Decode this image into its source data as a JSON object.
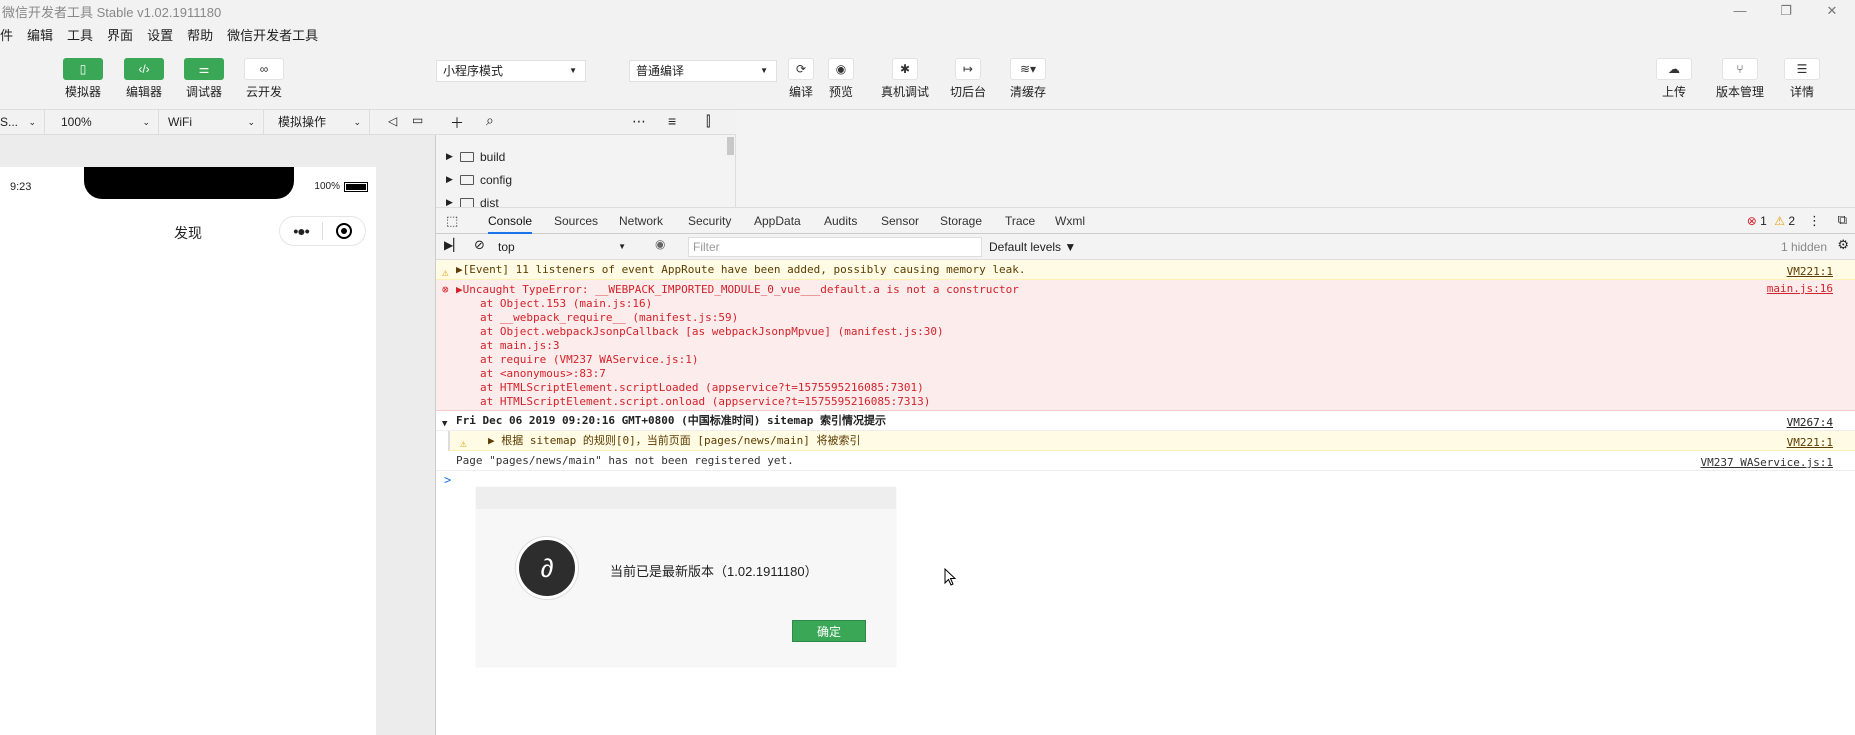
{
  "window": {
    "title": "微信开发者工具 Stable v1.02.1911180",
    "min": "—",
    "restore": "❐",
    "close": "✕"
  },
  "menu": [
    "件",
    "编辑",
    "工具",
    "界面",
    "设置",
    "帮助",
    "微信开发者工具"
  ],
  "toolbar": {
    "simulator": "模拟器",
    "editor": "编辑器",
    "debugger": "调试器",
    "cloud": "云开发",
    "mode_select": "小程序模式",
    "compile_select": "普通编译",
    "compile": "编译",
    "preview": "预览",
    "remote_debug": "真机调试",
    "background": "切后台",
    "clear_cache": "清缓存",
    "upload": "上传",
    "version_mgmt": "版本管理",
    "details": "详情"
  },
  "simbar": {
    "device": "S...",
    "zoom": "100%",
    "network": "WiFi",
    "operation": "模拟操作"
  },
  "phone": {
    "time": "9:23",
    "battery": "100%",
    "nav_title": "发现",
    "capsule_dots": "•●•"
  },
  "explorer": {
    "items": [
      "build",
      "config",
      "dist"
    ]
  },
  "devtools": {
    "tabs": [
      "Console",
      "Sources",
      "Network",
      "Security",
      "AppData",
      "Audits",
      "Sensor",
      "Storage",
      "Trace",
      "Wxml"
    ],
    "errors": "1",
    "warnings": "2",
    "context": "top",
    "filter_placeholder": "Filter",
    "levels": "Default levels ▼",
    "hidden": "1 hidden"
  },
  "console": {
    "warn1_text": "▶[Event] 11 listeners of event AppRoute have been added, possibly causing memory leak.",
    "warn1_link": "VM221:1",
    "err_text": "▶Uncaught TypeError: __WEBPACK_IMPORTED_MODULE_0_vue___default.a is not a constructor",
    "err_link": "main.js:16",
    "stack": [
      "at Object.153 (main.js:16)",
      "at __webpack_require__ (manifest.js:59)",
      "at Object.webpackJsonpCallback [as webpackJsonpMpvue] (manifest.js:30)",
      "at main.js:3",
      "at require (VM237 WAService.js:1)",
      "at <anonymous>:83:7",
      "at HTMLScriptElement.scriptLoaded (appservice?t=1575595216085:7301)",
      "at HTMLScriptElement.script.onload (appservice?t=1575595216085:7313)"
    ],
    "group_text": "Fri Dec 06 2019 09:20:16 GMT+0800 (中国标准时间) sitemap 索引情况提示",
    "group_link": "VM267:4",
    "warn2_text": "▶ 根据 sitemap 的规则[0]，当前页面 [pages/news/main] 将被索引",
    "warn2_link": "VM221:1",
    "log_text": "Page \"pages/news/main\" has not been registered yet.",
    "log_link": "VM237 WAService.js:1",
    "prompt": ">"
  },
  "dialog": {
    "message": "当前已是最新版本（1.02.1911180）",
    "ok": "确定"
  },
  "colors": {
    "accent": "#3aa757",
    "error": "#d4222a",
    "warning_bg": "#fffbe5",
    "devtools_tab": "#1a73e8"
  }
}
